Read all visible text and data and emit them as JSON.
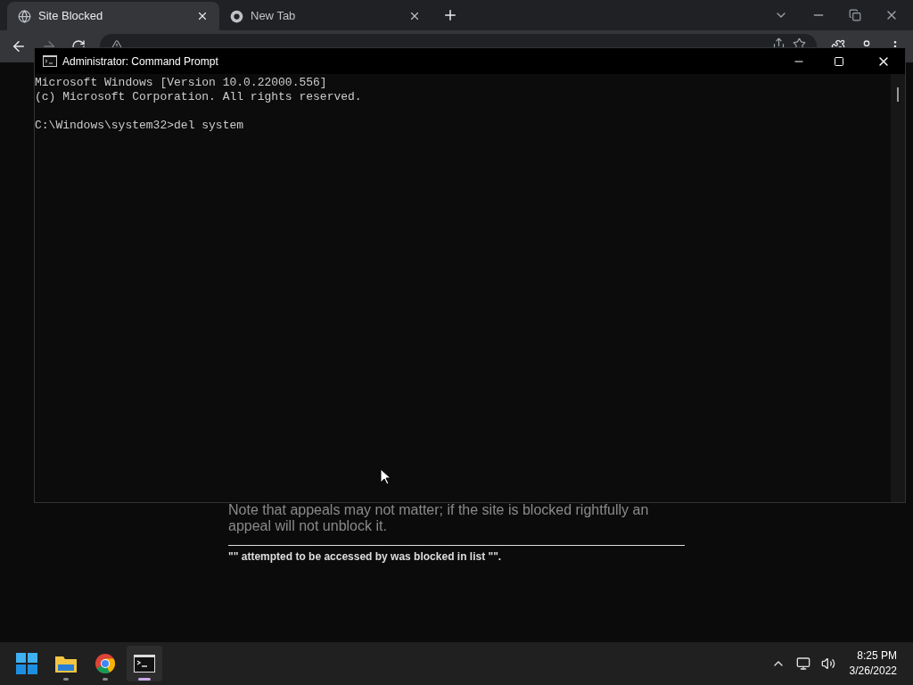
{
  "browser": {
    "tabs": [
      {
        "title": "Site Blocked",
        "selected": true
      },
      {
        "title": "New Tab",
        "selected": false
      }
    ]
  },
  "page": {
    "note": "Note that appeals may not matter; if the site is blocked rightfully an appeal will not unblock it.",
    "footer": "\"\" attempted to be accessed by was blocked in list \"\"."
  },
  "console": {
    "title": "Administrator: Command Prompt",
    "lines": [
      "Microsoft Windows [Version 10.0.22000.556]",
      "(c) Microsoft Corporation. All rights reserved."
    ],
    "prompt": "C:\\Windows\\system32>del system"
  },
  "taskbar": {
    "apps": [
      {
        "kind": "start",
        "running": false,
        "selected": false
      },
      {
        "kind": "folder",
        "running": true,
        "selected": false
      },
      {
        "kind": "browser",
        "running": true,
        "selected": false
      },
      {
        "kind": "terminal",
        "running": true,
        "selected": true
      }
    ],
    "time": "8:25 PM",
    "date": "3/26/2022"
  }
}
